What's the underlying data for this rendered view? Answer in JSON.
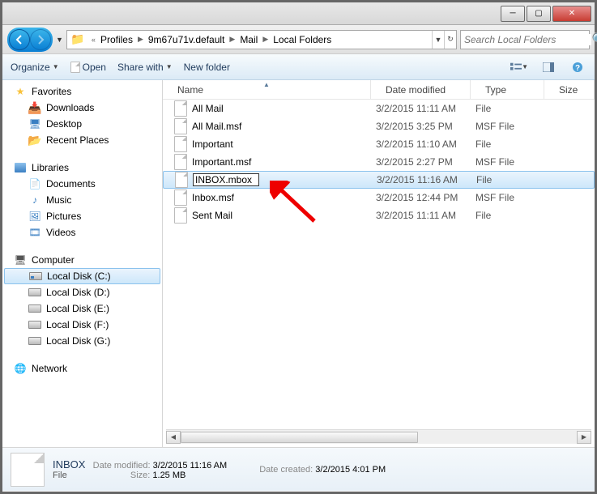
{
  "breadcrumb": {
    "prefix": "«",
    "items": [
      "Profiles",
      "9m67u71v.default",
      "Mail",
      "Local Folders"
    ]
  },
  "search": {
    "placeholder": "Search Local Folders"
  },
  "toolbar": {
    "organize": "Organize",
    "open": "Open",
    "share": "Share with",
    "newfolder": "New folder"
  },
  "nav": {
    "favorites": {
      "label": "Favorites",
      "items": [
        "Downloads",
        "Desktop",
        "Recent Places"
      ]
    },
    "libraries": {
      "label": "Libraries",
      "items": [
        "Documents",
        "Music",
        "Pictures",
        "Videos"
      ]
    },
    "computer": {
      "label": "Computer",
      "items": [
        "Local Disk (C:)",
        "Local Disk (D:)",
        "Local Disk (E:)",
        "Local Disk (F:)",
        "Local Disk (G:)"
      ],
      "selected": 0
    },
    "network": {
      "label": "Network"
    }
  },
  "columns": {
    "name": "Name",
    "date": "Date modified",
    "type": "Type",
    "size": "Size"
  },
  "files": [
    {
      "name": "All Mail",
      "date": "3/2/2015 11:11 AM",
      "type": "File",
      "editing": false
    },
    {
      "name": "All Mail.msf",
      "date": "3/2/2015 3:25 PM",
      "type": "MSF File",
      "editing": false
    },
    {
      "name": "Important",
      "date": "3/2/2015 11:10 AM",
      "type": "File",
      "editing": false
    },
    {
      "name": "Important.msf",
      "date": "3/2/2015 2:27 PM",
      "type": "MSF File",
      "editing": false
    },
    {
      "name": "INBOX.mbox",
      "date": "3/2/2015 11:16 AM",
      "type": "File",
      "editing": true
    },
    {
      "name": "Inbox.msf",
      "date": "3/2/2015 12:44 PM",
      "type": "MSF File",
      "editing": false
    },
    {
      "name": "Sent Mail",
      "date": "3/2/2015 11:11 AM",
      "type": "File",
      "editing": false
    }
  ],
  "details": {
    "name": "INBOX",
    "type": "File",
    "modified_label": "Date modified:",
    "modified": "3/2/2015 11:16 AM",
    "size_label": "Size:",
    "size": "1.25 MB",
    "created_label": "Date created:",
    "created": "3/2/2015 4:01 PM"
  }
}
